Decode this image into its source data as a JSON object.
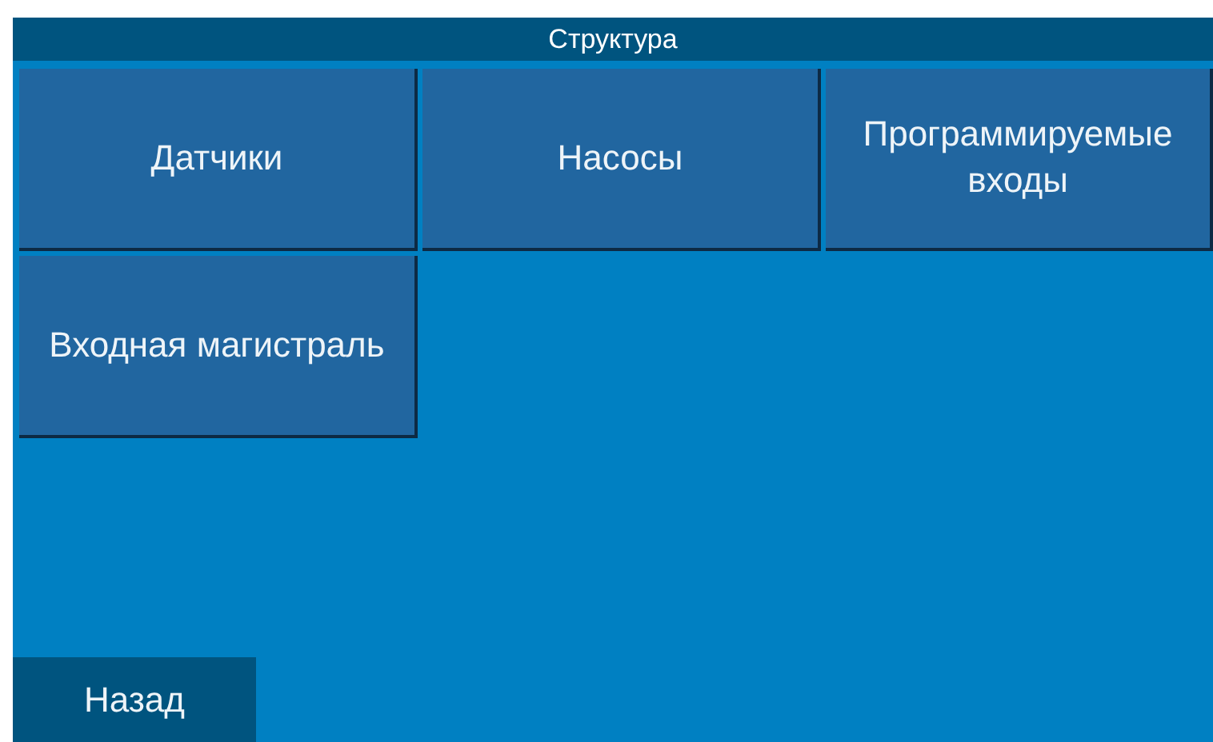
{
  "window": {
    "title": "Структура"
  },
  "menu_buttons": [
    {
      "label": "Датчики"
    },
    {
      "label": "Насосы"
    },
    {
      "label": "Программируемые входы"
    },
    {
      "label": "Входная магистраль"
    }
  ],
  "back_button": {
    "label": "Назад"
  }
}
